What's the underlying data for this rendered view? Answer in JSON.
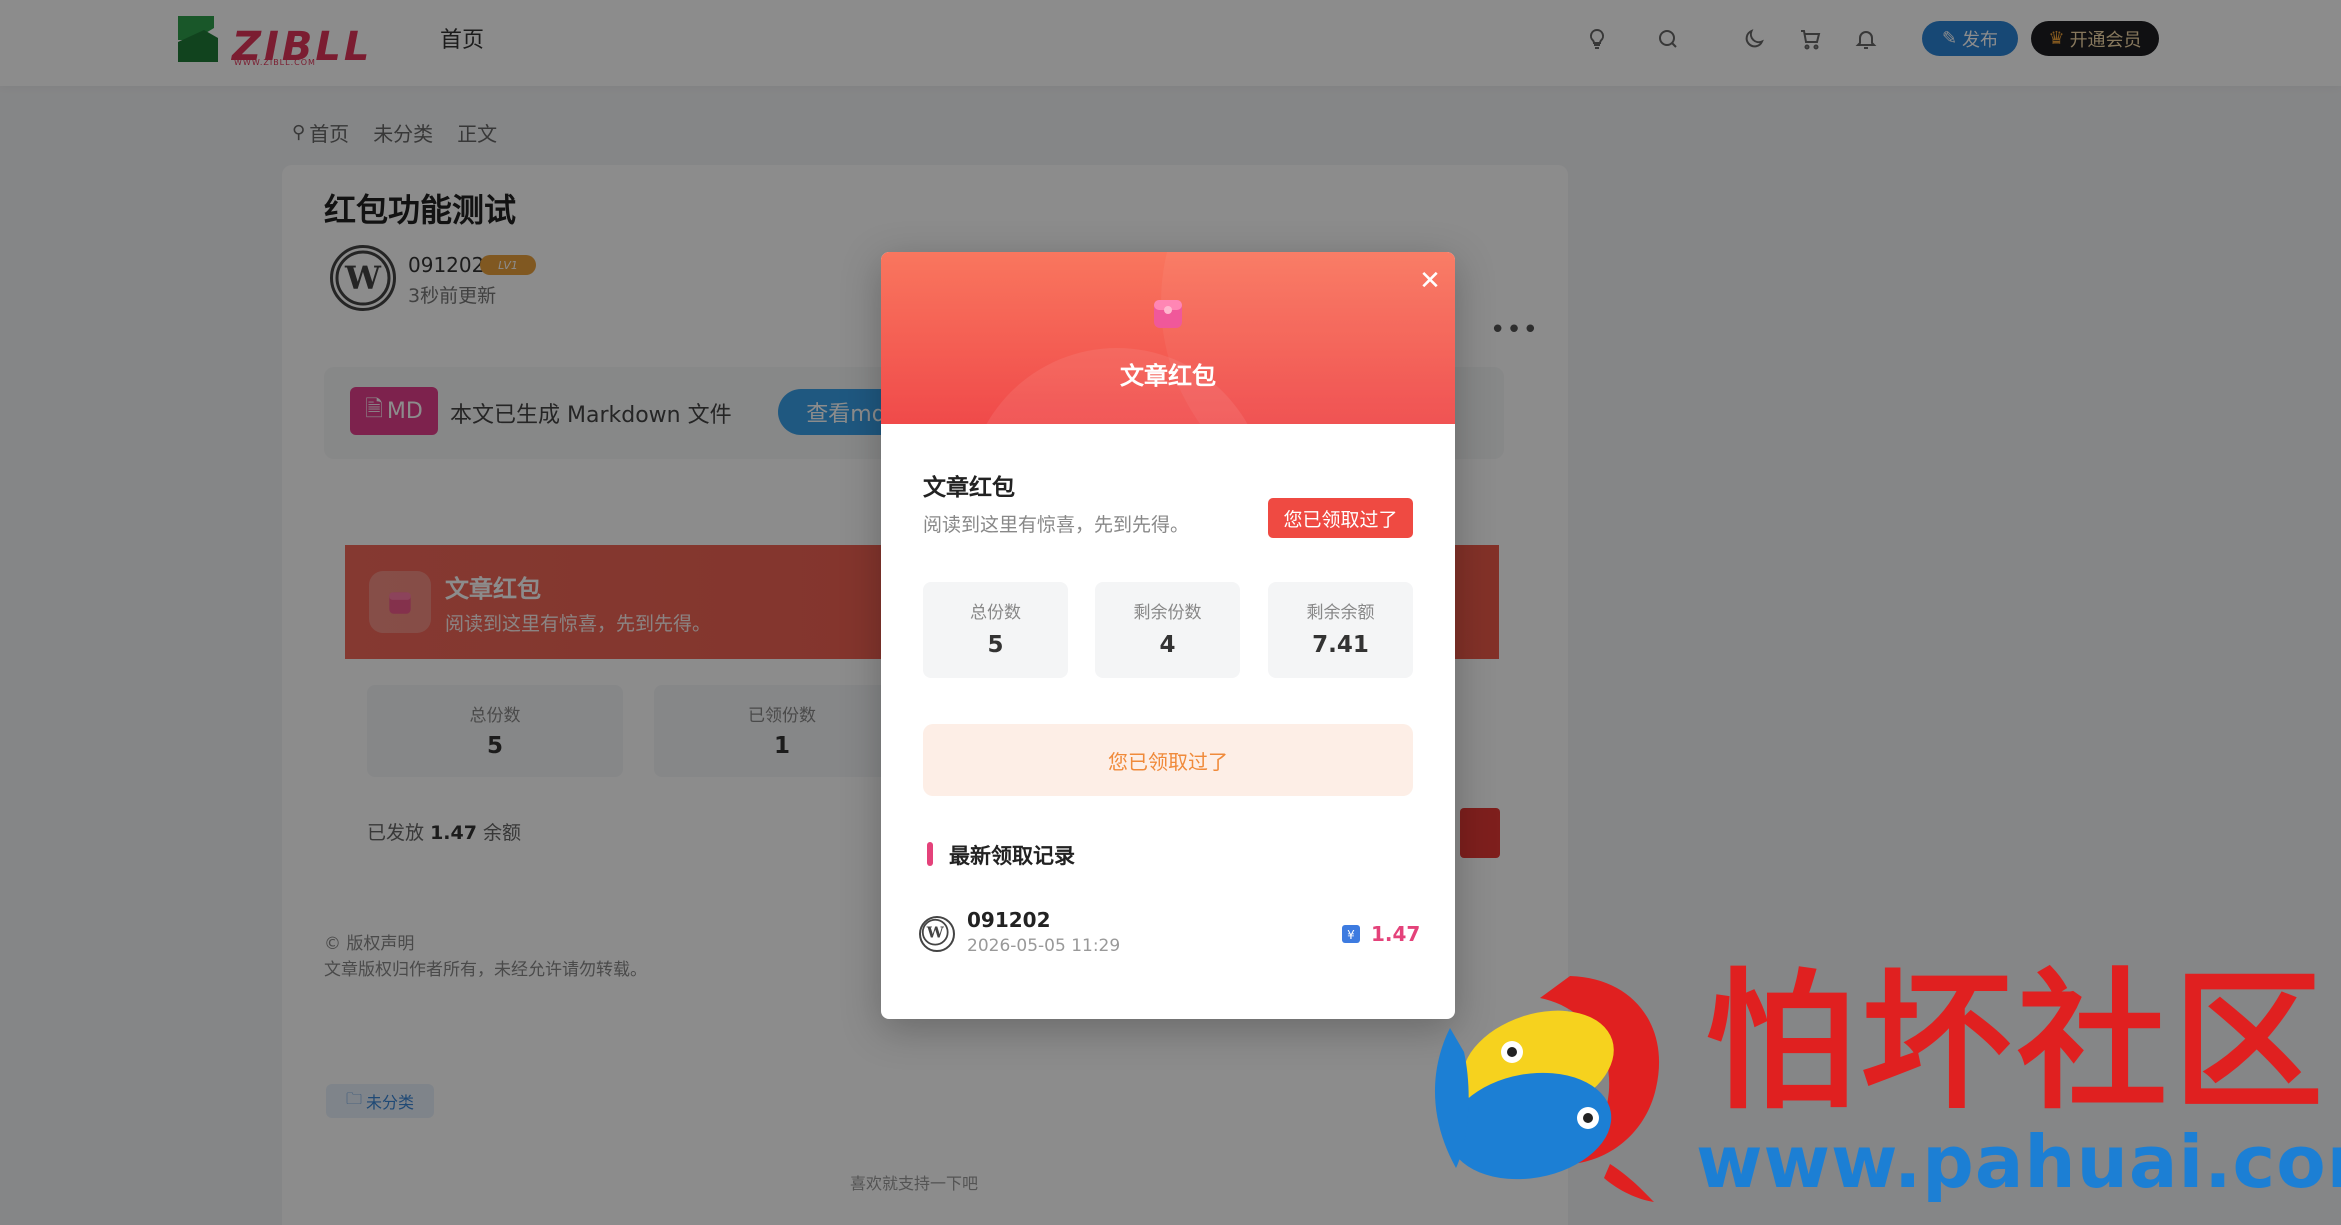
{
  "header": {
    "logo_text": "ZIBLL",
    "logo_sub": "WWW.ZIBLL.COM",
    "nav_home": "首页",
    "publish_label": "发布",
    "vip_label": "开通会员"
  },
  "breadcrumb": [
    "首页",
    "未分类",
    "正文"
  ],
  "article": {
    "title": "红包功能测试",
    "author": "091202",
    "level": "LV1",
    "updated": "3秒前更新",
    "md_badge": "MD",
    "md_text": "本文已生成 Markdown 文件",
    "md_button": "查看md文件",
    "redpacket_title": "文章红包",
    "redpacket_sub": "阅读到这里有惊喜，先到先得。",
    "stats": [
      {
        "label": "总份数",
        "value": "5"
      },
      {
        "label": "已领份数",
        "value": "1"
      }
    ],
    "issued_prefix": "已发放",
    "issued_amount": "1.47",
    "issued_suffix": "余额",
    "copyright_title": "© 版权声明",
    "copyright_text": "文章版权归作者所有，未经允许请勿转载。",
    "tag": "未分类",
    "like_text": "喜欢就支持一下吧"
  },
  "modal": {
    "header_title": "文章红包",
    "title": "文章红包",
    "subtitle": "阅读到这里有惊喜，先到先得。",
    "status_badge": "您已领取过了",
    "stats": [
      {
        "label": "总份数",
        "value": "5"
      },
      {
        "label": "剩余份数",
        "value": "4"
      },
      {
        "label": "剩余余额",
        "value": "7.41"
      }
    ],
    "claimed_button": "您已领取过了",
    "records_title": "最新领取记录",
    "records": [
      {
        "name": "091202",
        "time": "2026-05-05 11:29",
        "amount": "1.47"
      }
    ]
  },
  "watermark": {
    "name": "怕坏社区",
    "url": "www.pahuai.com"
  },
  "colors": {
    "accent_red": "#f04a4a",
    "brand_pink": "#e4427a",
    "publish_blue": "#2b83d6"
  }
}
